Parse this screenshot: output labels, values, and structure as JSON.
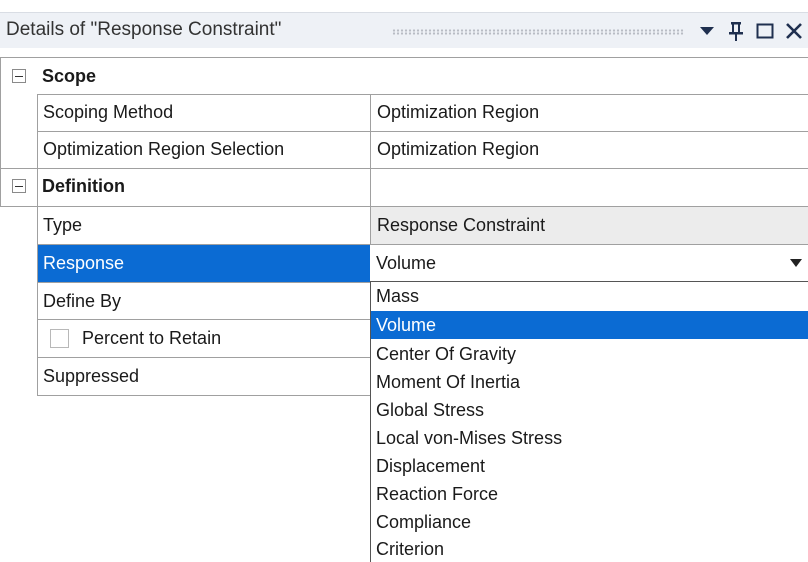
{
  "panel": {
    "title": "Details of \"Response Constraint\"",
    "icons": [
      "dropdown-arrow-icon",
      "pin-icon",
      "maximize-icon",
      "close-icon"
    ]
  },
  "groups": {
    "scope": {
      "label": "Scope",
      "rows": [
        {
          "name": "Scoping Method",
          "value": "Optimization Region"
        },
        {
          "name": "Optimization Region Selection",
          "value": "Optimization Region"
        }
      ]
    },
    "definition": {
      "label": "Definition",
      "rows": [
        {
          "name": "Type",
          "value": "Response Constraint"
        },
        {
          "name": "Response",
          "value": "Volume"
        },
        {
          "name": "Define By",
          "value": ""
        },
        {
          "name": "Percent to Retain",
          "value": ""
        },
        {
          "name": "Suppressed",
          "value": ""
        }
      ]
    }
  },
  "dropdown": {
    "selected": "Volume",
    "options": [
      "Mass",
      "Volume",
      "Center Of Gravity",
      "Moment Of Inertia",
      "Global Stress",
      "Local von-Mises Stress",
      "Displacement",
      "Reaction Force",
      "Compliance",
      "Criterion"
    ]
  },
  "colors": {
    "selection": "#0b6bd3",
    "readonly": "#ececec",
    "title_bar": "#eef1f6"
  }
}
